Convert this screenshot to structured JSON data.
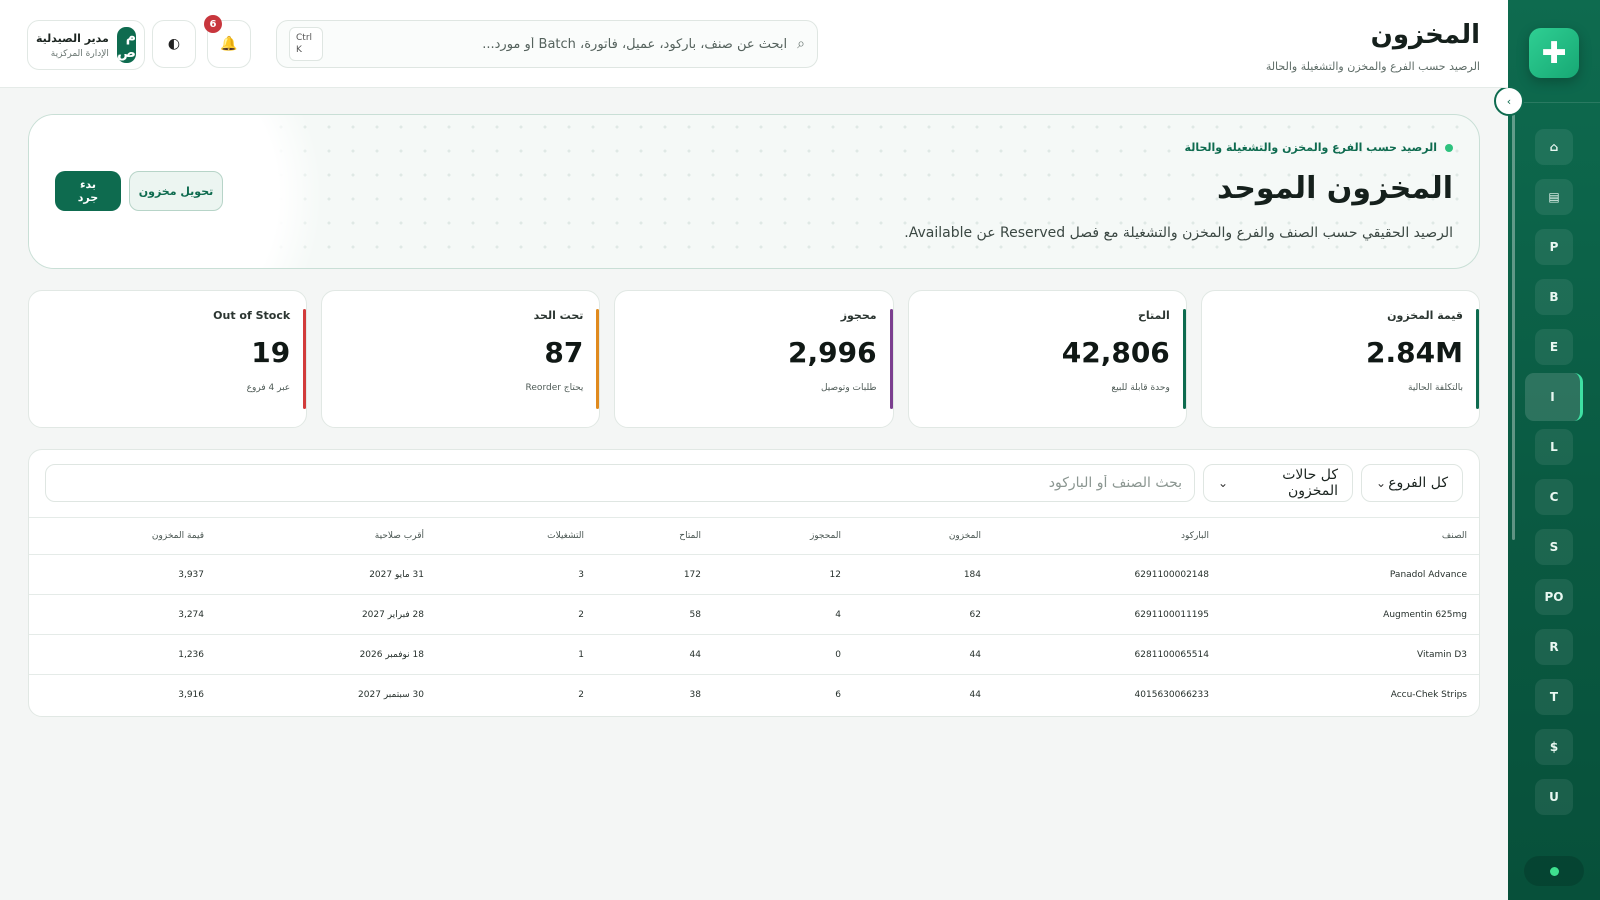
{
  "header": {
    "title": "المخزون",
    "subtitle": "الرصيد حسب الفرع والمخزن والتشغيلة والحالة",
    "search_placeholder": "ابحث عن صنف، باركود، عميل، فاتورة، Batch أو مورد...",
    "shortcut_ctrl": "Ctrl",
    "shortcut_key": "K",
    "notification_count": "6",
    "user": {
      "name": "مدير الصيدلية",
      "role": "الإدارة المركزية",
      "initials": "م ص"
    }
  },
  "sidebar": {
    "items": [
      {
        "label": "⌂",
        "icon": "home-icon"
      },
      {
        "label": "▤",
        "icon": "register-icon"
      },
      {
        "label": "P"
      },
      {
        "label": "B"
      },
      {
        "label": "E"
      },
      {
        "label": "I",
        "active": true
      },
      {
        "label": "L"
      },
      {
        "label": "C"
      },
      {
        "label": "S"
      },
      {
        "label": "PO"
      },
      {
        "label": "R"
      },
      {
        "label": "T"
      },
      {
        "label": "$"
      },
      {
        "label": "U"
      }
    ],
    "accent": "#0e6b4f"
  },
  "hero": {
    "eyebrow": "الرصيد حسب الفرع والمخزن والتشغيلة والحالة",
    "title": "المخزون الموحد",
    "description": "الرصيد الحقيقي حسب الصنف والفرع والمخزن والتشغيلة مع فصل Reserved عن Available.",
    "primary_action": "بدء جرد",
    "secondary_action": "تحويل مخزون"
  },
  "kpis": [
    {
      "label": "قيمة المخزون",
      "value": "2.84M",
      "hint": "بالتكلفة الحالية",
      "color": "#0e6b4f"
    },
    {
      "label": "المتاح",
      "value": "42,806",
      "hint": "وحدة قابلة للبيع",
      "color": "#0e6b4f"
    },
    {
      "label": "محجوز",
      "value": "2,996",
      "hint": "طلبات وتوصيل",
      "color": "#7b3f8f"
    },
    {
      "label": "تحت الحد",
      "value": "87",
      "hint": "يحتاج Reorder",
      "color": "#e08a1e"
    },
    {
      "label": "Out of Stock",
      "value": "19",
      "hint": "عبر 4 فروع",
      "color": "#d23b3b"
    }
  ],
  "filters": {
    "branch": "كل الفروع",
    "status": "كل حالات المخزون",
    "search_placeholder": "بحث الصنف أو الباركود"
  },
  "table": {
    "headers": {
      "name": "الصنف",
      "barcode": "الباركود",
      "stock": "المخزون",
      "reserved": "المحجوز",
      "available": "المتاح",
      "batches": "التشغيلات",
      "expiry": "أقرب صلاحية",
      "value": "قيمة المخزون"
    },
    "rows": [
      {
        "name": "Panadol Advance",
        "barcode": "6291100002148",
        "stock": "184",
        "reserved": "12",
        "available": "172",
        "batches": "3",
        "expiry": "31 مايو 2027",
        "value": "3,937"
      },
      {
        "name": "Augmentin 625mg",
        "barcode": "6291100011195",
        "stock": "62",
        "reserved": "4",
        "available": "58",
        "batches": "2",
        "expiry": "28 فبراير 2027",
        "value": "3,274"
      },
      {
        "name": "Vitamin D3",
        "barcode": "6281100065514",
        "stock": "44",
        "reserved": "0",
        "available": "44",
        "batches": "1",
        "expiry": "18 نوفمبر 2026",
        "value": "1,236"
      },
      {
        "name": "Accu-Chek Strips",
        "barcode": "4015630066233",
        "stock": "44",
        "reserved": "6",
        "available": "38",
        "batches": "2",
        "expiry": "30 سبتمبر 2027",
        "value": "3,916"
      }
    ]
  }
}
